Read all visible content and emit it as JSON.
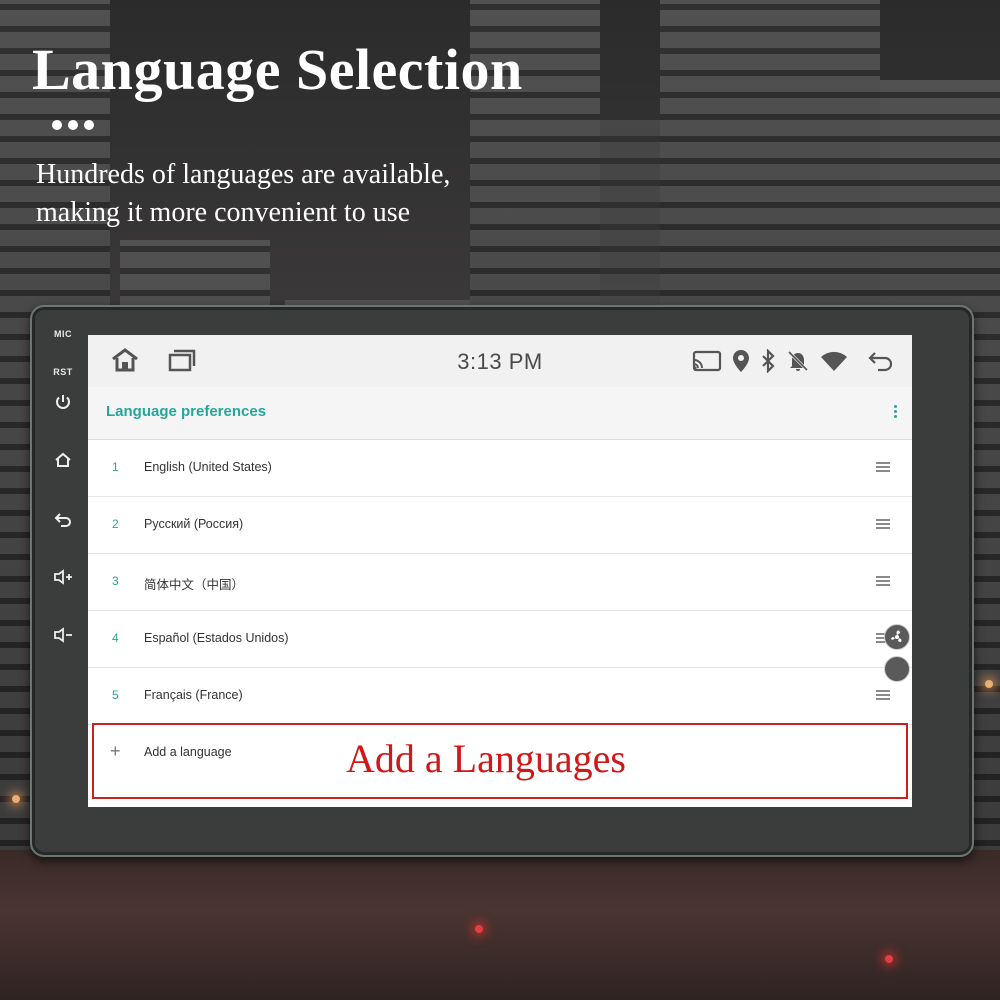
{
  "title": "Language Selection",
  "subtitle": {
    "line1": "Hundreds of  languages are available,",
    "line2": "making it more convenient to use"
  },
  "device": {
    "side_buttons": [
      {
        "label": "MIC",
        "icon": "mic-label"
      },
      {
        "label": "RST",
        "icon": "reset-label"
      },
      {
        "label": "",
        "icon": "power-icon"
      },
      {
        "label": "",
        "icon": "home-icon"
      },
      {
        "label": "",
        "icon": "back-icon"
      },
      {
        "label": "",
        "icon": "volume-up-icon"
      },
      {
        "label": "",
        "icon": "volume-down-icon"
      }
    ],
    "status_bar": {
      "time": "3:13 PM",
      "left_icons": [
        "home-icon",
        "recent-apps-icon"
      ],
      "right_icons": [
        "cast-icon",
        "location-icon",
        "bluetooth-icon",
        "notifications-off-icon",
        "wifi-icon",
        "back-icon"
      ]
    },
    "app_bar": {
      "title": "Language preferences",
      "accent": "#26a69a"
    },
    "languages": [
      {
        "num": "1",
        "label": "English (United States)"
      },
      {
        "num": "2",
        "label": "Русский (Россия)"
      },
      {
        "num": "3",
        "label": "简体中文（中国）"
      },
      {
        "num": "4",
        "label": "Español (Estados Unidos)"
      },
      {
        "num": "5",
        "label": "Français (France)"
      }
    ],
    "add_language": {
      "label": "Add a language",
      "callout": "Add a Languages",
      "highlight_color": "#cc1f1f"
    }
  }
}
